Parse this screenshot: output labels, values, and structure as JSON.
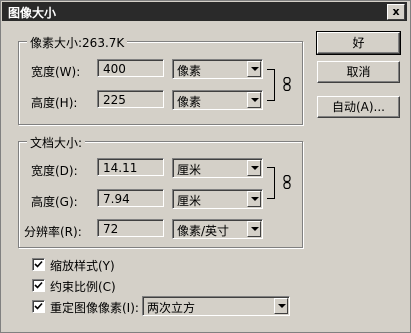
{
  "window": {
    "title": "图像大小",
    "close_glyph": "x"
  },
  "pixel_dimensions": {
    "legend": "像素大小:263.7K",
    "width_label": "宽度(W):",
    "width_value": "400",
    "width_unit": "像素",
    "height_label": "高度(H):",
    "height_value": "225",
    "height_unit": "像素"
  },
  "document_size": {
    "legend": "文档大小:",
    "width_label": "宽度(D):",
    "width_value": "14.11",
    "width_unit": "厘米",
    "height_label": "高度(G):",
    "height_value": "7.94",
    "height_unit": "厘米",
    "resolution_label": "分辨率(R):",
    "resolution_value": "72",
    "resolution_unit": "像素/英寸"
  },
  "buttons": {
    "ok": "好",
    "cancel": "取消",
    "auto": "自动(A)..."
  },
  "options": {
    "scale_styles": "缩放样式(Y)",
    "scale_styles_checked": true,
    "constrain": "约束比例(C)",
    "constrain_checked": true,
    "resample": "重定图像像素(I):",
    "resample_checked": true,
    "resample_method": "两次立方"
  },
  "icons": {
    "link": "chain-link-icon",
    "dropdown": "chevron-down-icon",
    "check": "checkmark-icon"
  }
}
